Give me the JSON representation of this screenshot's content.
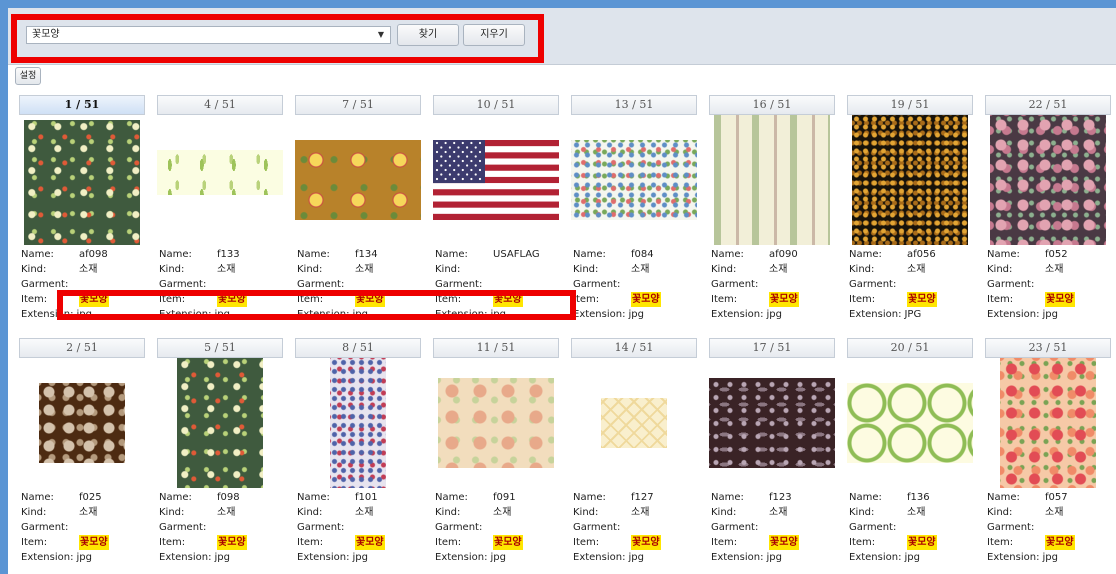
{
  "search": {
    "selected_value": "꽃모양",
    "find_label": "찾기",
    "clear_label": "지우기"
  },
  "toolbar": {
    "settings_label": "설정"
  },
  "field_labels": {
    "name": "Name:",
    "kind": "Kind:",
    "garment": "Garment:",
    "item": "Item:",
    "extension": "Extension:"
  },
  "results": [
    {
      "page": "1 / 51",
      "name": "af098",
      "kind": "소재",
      "garment": "",
      "item": "꽃모양",
      "extension": "jpg",
      "selected": true,
      "pattern": "dark green floral"
    },
    {
      "page": "4 / 51",
      "name": "f133",
      "kind": "소재",
      "garment": "",
      "item": "꽃모양",
      "extension": "jpg",
      "pattern": "cream sprigs"
    },
    {
      "page": "7 / 51",
      "name": "f134",
      "kind": "소재",
      "garment": "",
      "item": "꽃모양",
      "extension": "jpg",
      "pattern": "orange yellow flowers"
    },
    {
      "page": "10 / 51",
      "name": "USAFLAG",
      "kind": "",
      "garment": "",
      "item": "꽃모양",
      "extension": "jpg",
      "pattern": "us flag"
    },
    {
      "page": "13 / 51",
      "name": "f084",
      "kind": "소재",
      "garment": "",
      "item": "꽃모양",
      "extension": "jpg",
      "pattern": "white small floral"
    },
    {
      "page": "16 / 51",
      "name": "af090",
      "kind": "소재",
      "garment": "",
      "item": "꽃모양",
      "extension": "jpg",
      "pattern": "vertical stripes"
    },
    {
      "page": "19 / 51",
      "name": "af056",
      "kind": "소재",
      "garment": "",
      "item": "꽃모양",
      "extension": "JPG",
      "pattern": "black gold floral"
    },
    {
      "page": "22 / 51",
      "name": "f052",
      "kind": "소재",
      "garment": "",
      "item": "꽃모양",
      "extension": "jpg",
      "pattern": "dark roses"
    },
    {
      "page": "2 / 51",
      "name": "f025",
      "kind": "소재",
      "garment": "",
      "item": "꽃모양",
      "extension": "jpg",
      "pattern": "brown floral"
    },
    {
      "page": "5 / 51",
      "name": "f098",
      "kind": "소재",
      "garment": "",
      "item": "꽃모양",
      "extension": "jpg",
      "pattern": "dark green floral"
    },
    {
      "page": "8 / 51",
      "name": "f101",
      "kind": "소재",
      "garment": "",
      "item": "꽃모양",
      "extension": "jpg",
      "pattern": "lilac floral"
    },
    {
      "page": "11 / 51",
      "name": "f091",
      "kind": "소재",
      "garment": "",
      "item": "꽃모양",
      "extension": "jpg",
      "pattern": "peach floral"
    },
    {
      "page": "14 / 51",
      "name": "f127",
      "kind": "소재",
      "garment": "",
      "item": "꽃모양",
      "extension": "jpg",
      "pattern": "cream lattice"
    },
    {
      "page": "17 / 51",
      "name": "f123",
      "kind": "소재",
      "garment": "",
      "item": "꽃모양",
      "extension": "jpg",
      "pattern": "dark floral"
    },
    {
      "page": "20 / 51",
      "name": "f136",
      "kind": "소재",
      "garment": "",
      "item": "꽃모양",
      "extension": "jpg",
      "pattern": "green wreath"
    },
    {
      "page": "23 / 51",
      "name": "f057",
      "kind": "소재",
      "garment": "",
      "item": "꽃모양",
      "extension": "jpg",
      "pattern": "pink floral"
    }
  ],
  "colors": {
    "highlight_box": "#ee0000",
    "item_highlight": "#ffe600",
    "frame_blue": "#5b95d4"
  }
}
